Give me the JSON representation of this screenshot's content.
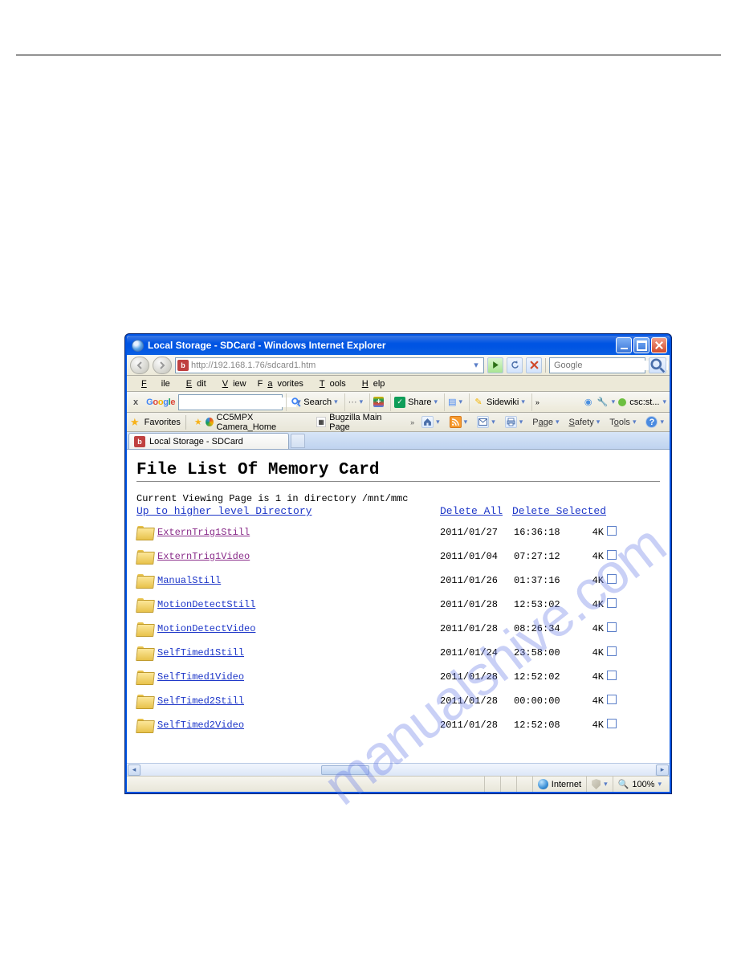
{
  "watermark": "manualshive.com",
  "window": {
    "title": "Local Storage - SDCard - Windows Internet Explorer"
  },
  "address": {
    "url": "http://192.168.1.76/sdcard1.htm"
  },
  "search": {
    "placeholder": "Google",
    "value": ""
  },
  "menu": {
    "file": "File",
    "edit": "Edit",
    "view": "View",
    "favorites": "Favorites",
    "tools": "Tools",
    "help": "Help"
  },
  "google_tb": {
    "search_label": "Search",
    "share_label": "Share",
    "sidewiki_label": "Sidewiki",
    "status_text": "csc:st..."
  },
  "fav": {
    "favorites": "Favorites",
    "link1": "CC5MPX Camera_Home",
    "link2": "Bugzilla Main Page"
  },
  "cmd": {
    "page": "Page",
    "safety": "Safety",
    "tools": "Tools"
  },
  "tab": {
    "title": "Local Storage - SDCard"
  },
  "page": {
    "h1": "File List Of Memory Card",
    "current": "Current Viewing Page is 1 in directory /mnt/mmc",
    "up": "Up to higher level Directory",
    "delete_all": "Delete All",
    "delete_selected": "Delete Selected"
  },
  "rows": [
    {
      "name": "ExternTrig1Still",
      "date": "2011/01/27",
      "time": "16:36:18",
      "size": "4K",
      "visited": true
    },
    {
      "name": "ExternTrig1Video",
      "date": "2011/01/04",
      "time": "07:27:12",
      "size": "4K",
      "visited": true
    },
    {
      "name": "ManualStill",
      "date": "2011/01/26",
      "time": "01:37:16",
      "size": "4K",
      "visited": false
    },
    {
      "name": "MotionDetectStill",
      "date": "2011/01/28",
      "time": "12:53:02",
      "size": "4K",
      "visited": false
    },
    {
      "name": "MotionDetectVideo",
      "date": "2011/01/28",
      "time": "08:26:34",
      "size": "4K",
      "visited": false
    },
    {
      "name": "SelfTimed1Still",
      "date": "2011/01/24",
      "time": "23:58:00",
      "size": "4K",
      "visited": false
    },
    {
      "name": "SelfTimed1Video",
      "date": "2011/01/28",
      "time": "12:52:02",
      "size": "4K",
      "visited": false
    },
    {
      "name": "SelfTimed2Still",
      "date": "2011/01/28",
      "time": "00:00:00",
      "size": "4K",
      "visited": false
    },
    {
      "name": "SelfTimed2Video",
      "date": "2011/01/28",
      "time": "12:52:08",
      "size": "4K",
      "visited": false
    }
  ],
  "status": {
    "zone": "Internet",
    "zoom": "100%"
  }
}
